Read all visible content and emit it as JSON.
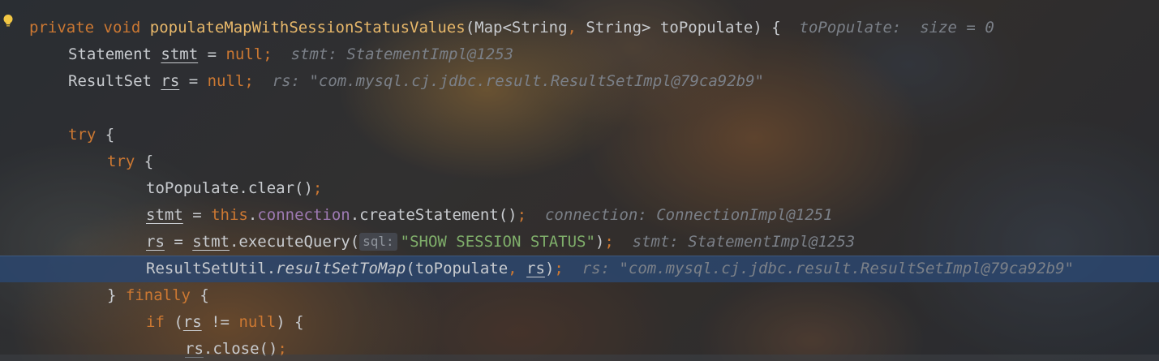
{
  "editor": {
    "lines": [
      {
        "parts": [
          "private",
          " ",
          "void",
          " ",
          "populateMapWithSessionStatusValues",
          "(Map<String",
          ",",
          " String> toPopulate) {",
          "  toPopulate:  size = 0"
        ]
      },
      {
        "parts": [
          "Statement ",
          "stmt",
          " = ",
          "null",
          ";",
          "  stmt: StatementImpl@1253"
        ]
      },
      {
        "parts": [
          "ResultSet ",
          "rs",
          " = ",
          "null",
          ";",
          "  rs: \"com.mysql.cj.jdbc.result.ResultSetImpl@79ca92b9\""
        ]
      },
      {
        "parts": []
      },
      {
        "parts": [
          "try",
          " {"
        ]
      },
      {
        "parts": [
          "try",
          " {"
        ]
      },
      {
        "parts": [
          "toPopulate.clear()",
          ";"
        ]
      },
      {
        "parts": [
          "stmt",
          " = ",
          "this",
          ".",
          "connection",
          ".createStatement()",
          ";",
          "  connection: ConnectionImpl@1251"
        ]
      },
      {
        "parts": [
          "rs",
          " = ",
          "stmt",
          ".executeQuery(",
          "sql:",
          "\"SHOW SESSION STATUS\"",
          ")",
          ";",
          "  stmt: StatementImpl@1253"
        ]
      },
      {
        "parts": [
          "ResultSetUtil.",
          "resultSetToMap",
          "(toPopulate",
          ", ",
          "rs",
          ")",
          ";",
          "  rs: \"com.mysql.cj.jdbc.result.ResultSetImpl@79ca92b9\""
        ]
      },
      {
        "parts": [
          "} ",
          "finally",
          " {"
        ]
      },
      {
        "parts": [
          "if",
          " (",
          "rs",
          " != ",
          "null",
          ") {"
        ]
      },
      {
        "parts": [
          "rs",
          ".close()",
          ";"
        ]
      }
    ]
  },
  "icons": {
    "gutter": "intention-bulb-icon"
  },
  "colors": {
    "keyword": "#cc7832",
    "method": "#e8b86a",
    "field": "#9e7ab3",
    "string": "#7fae6a",
    "hint": "#7b8088",
    "current_line": "#2c466e"
  }
}
